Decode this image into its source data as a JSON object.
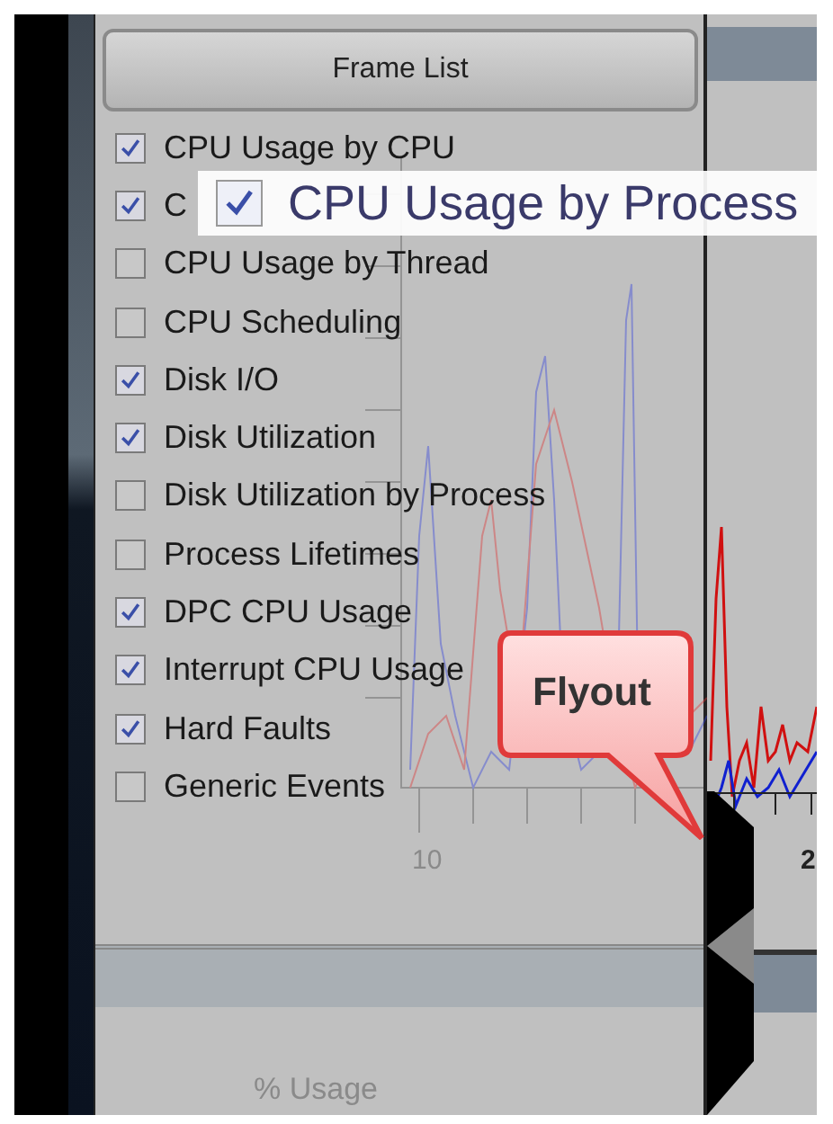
{
  "panel": {
    "header_button": "Frame List",
    "items": [
      {
        "label": "CPU Usage by CPU",
        "checked": true
      },
      {
        "label": "C",
        "checked": true
      },
      {
        "label": "CPU Usage by Thread",
        "checked": false
      },
      {
        "label": "CPU Scheduling",
        "checked": false
      },
      {
        "label": "Disk I/O",
        "checked": true
      },
      {
        "label": "Disk Utilization",
        "checked": true
      },
      {
        "label": "Disk Utilization by Process",
        "checked": false
      },
      {
        "label": "Process Lifetimes",
        "checked": false
      },
      {
        "label": "DPC CPU Usage",
        "checked": true
      },
      {
        "label": "Interrupt CPU Usage",
        "checked": true
      },
      {
        "label": "Hard Faults",
        "checked": true
      },
      {
        "label": "Generic Events",
        "checked": false
      }
    ]
  },
  "drag_preview": {
    "label": "CPU Usage by Process",
    "checked": true
  },
  "callout": {
    "text": "Flyout"
  },
  "background_chart": {
    "x_label": "10",
    "y_title": "% Usage"
  },
  "right_chart": {
    "x_label": "2"
  }
}
